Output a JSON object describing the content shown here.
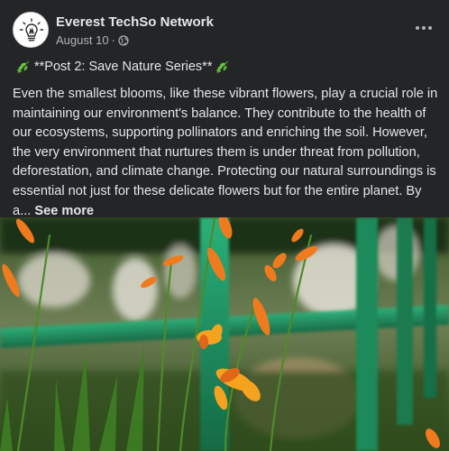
{
  "post": {
    "author": "Everest TechSo Network",
    "date": "August 10",
    "separator": "·",
    "audience_icon": "globe-icon",
    "title": "**Post 2: Save Nature Series**",
    "title_emoji": "herb-emoji",
    "body": "Even the smallest blooms, like these vibrant flowers, play a crucial role in maintaining our environment's balance. They contribute to the health of our ecosystems, supporting pollinators and enriching the soil. However, the very environment that nurtures them is under threat from pollution, deforestation, and climate change. Protecting our natural surroundings is essential not just for these delicate flowers but for the entire planet. By a...",
    "see_more": "See more",
    "more_options_icon": "more-horizontal-icon",
    "avatar_icon": "lightbulb-logo-icon"
  },
  "colors": {
    "background": "#242526",
    "text_primary": "#e4e6eb",
    "text_secondary": "#b0b3b8",
    "flower_orange": "#f07a1e",
    "railing_green": "#1f8a5a"
  }
}
